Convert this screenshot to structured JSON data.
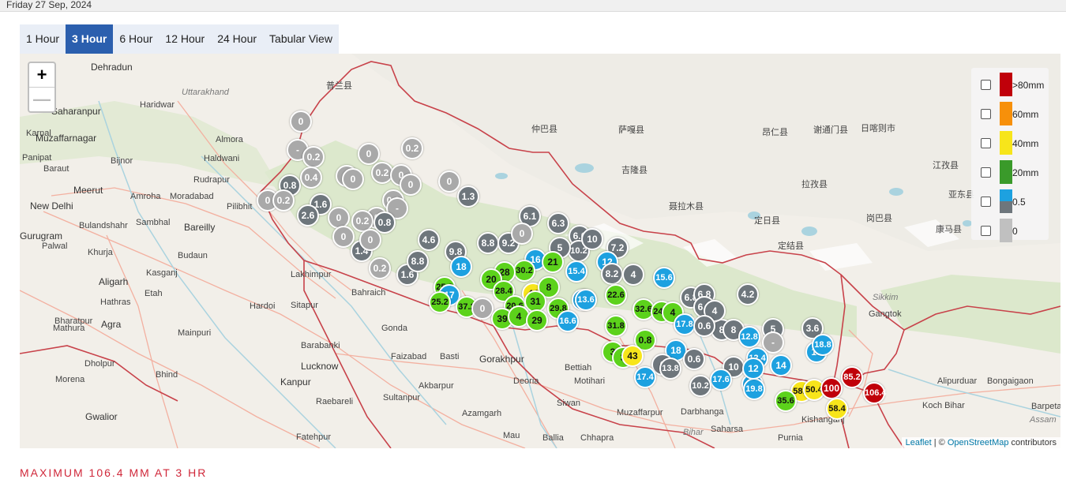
{
  "date": "Friday 27 Sep, 2024",
  "tabs": [
    {
      "label": "1 Hour",
      "active": false
    },
    {
      "label": "3 Hour",
      "active": true
    },
    {
      "label": "6 Hour",
      "active": false
    },
    {
      "label": "12 Hour",
      "active": false
    },
    {
      "label": "24 Hour",
      "active": false
    },
    {
      "label": "Tabular View",
      "active": false
    }
  ],
  "zoom": {
    "in": "+",
    "out": "—"
  },
  "legend": [
    {
      "label": ">80mm",
      "color": "#c0000a"
    },
    {
      "label": "60mm",
      "color": "#f7900a"
    },
    {
      "label": "40mm",
      "color": "#f7e51b"
    },
    {
      "label": "20mm",
      "color": "#3a9a2a"
    },
    {
      "label": "0.5",
      "color_top": "#1da1e0",
      "color_bottom": "#6e767c"
    },
    {
      "label": "0",
      "color": "#c0c0c0"
    }
  ],
  "places": [
    {
      "name": "Dehradun",
      "big": true
    },
    {
      "name": "Uttarakhand",
      "region": true
    },
    {
      "name": "Haridwar"
    },
    {
      "name": "Saharanpur",
      "big": true
    },
    {
      "name": "Karnal"
    },
    {
      "name": "Muzaffarnagar",
      "big": true
    },
    {
      "name": "Almora"
    },
    {
      "name": "Haldwani"
    },
    {
      "name": "Panipat"
    },
    {
      "name": "Baraut"
    },
    {
      "name": "Bijnor"
    },
    {
      "name": "Rudrapur"
    },
    {
      "name": "Meerut",
      "big": true
    },
    {
      "name": "Amroha"
    },
    {
      "name": "Moradabad"
    },
    {
      "name": "Pilibhit"
    },
    {
      "name": "New Delhi",
      "big": true
    },
    {
      "name": "Gurugram",
      "big": true
    },
    {
      "name": "Bulandshahr"
    },
    {
      "name": "Sambhal"
    },
    {
      "name": "Bareilly",
      "big": true
    },
    {
      "name": "Palwal"
    },
    {
      "name": "Khurja"
    },
    {
      "name": "Budaun"
    },
    {
      "name": "Lakhimpur"
    },
    {
      "name": "Aligarh",
      "big": true
    },
    {
      "name": "Kasganj"
    },
    {
      "name": "Hathras"
    },
    {
      "name": "Etah"
    },
    {
      "name": "Bahraich"
    },
    {
      "name": "Mathura"
    },
    {
      "name": "Hardoi"
    },
    {
      "name": "Sitapur"
    },
    {
      "name": "Bharatpur"
    },
    {
      "name": "Agra",
      "big": true
    },
    {
      "name": "Gonda"
    },
    {
      "name": "Mainpuri"
    },
    {
      "name": "Barabanki"
    },
    {
      "name": "Faizabad"
    },
    {
      "name": "Basti"
    },
    {
      "name": "Gorakhpur",
      "big": true
    },
    {
      "name": "Dholpur"
    },
    {
      "name": "Lucknow",
      "big": true
    },
    {
      "name": "Bettiah"
    },
    {
      "name": "Motihari"
    },
    {
      "name": "Morena"
    },
    {
      "name": "Bhind"
    },
    {
      "name": "Kanpur",
      "big": true
    },
    {
      "name": "Akbarpur"
    },
    {
      "name": "Deoria"
    },
    {
      "name": "Raebareli"
    },
    {
      "name": "Sultanpur"
    },
    {
      "name": "Siwan"
    },
    {
      "name": "Muzaffarpur"
    },
    {
      "name": "Darbhanga"
    },
    {
      "name": "Saharsa"
    },
    {
      "name": "Purnia"
    },
    {
      "name": "Gwalior",
      "big": true
    },
    {
      "name": "Azamgarh"
    },
    {
      "name": "Mau"
    },
    {
      "name": "Ballia"
    },
    {
      "name": "Chhapra"
    },
    {
      "name": "Fatehpur"
    },
    {
      "name": "Bihar",
      "region": true
    },
    {
      "name": "Kishanganj"
    },
    {
      "name": "Gangtok"
    },
    {
      "name": "Sikkim",
      "region": true
    },
    {
      "name": "Alipurduar"
    },
    {
      "name": "Bongaigaon"
    },
    {
      "name": "Koch Bihar"
    },
    {
      "name": "Barpeta"
    },
    {
      "name": "Assam",
      "region": true
    },
    {
      "name": "仲巴县"
    },
    {
      "name": "萨嘎县"
    },
    {
      "name": "吉隆县"
    },
    {
      "name": "聂拉木县"
    },
    {
      "name": "昂仁县"
    },
    {
      "name": "谢通门县"
    },
    {
      "name": "日喀则市"
    },
    {
      "name": "拉孜县"
    },
    {
      "name": "定日县"
    },
    {
      "name": "岗巴县"
    },
    {
      "name": "康马县"
    },
    {
      "name": "定结县"
    },
    {
      "name": "江孜县"
    },
    {
      "name": "亚东县"
    },
    {
      "name": "普兰县"
    }
  ],
  "markers": [
    {
      "v": "0",
      "c": "lgrey"
    },
    {
      "v": "-",
      "c": "lgrey"
    },
    {
      "v": "0.2",
      "c": "lgrey"
    },
    {
      "v": "0",
      "c": "lgrey"
    },
    {
      "v": "0.2",
      "c": "lgrey"
    },
    {
      "v": "0",
      "c": "lgrey"
    },
    {
      "v": "0.4",
      "c": "lgrey"
    },
    {
      "v": "0",
      "c": "lgrey"
    },
    {
      "v": "0.2",
      "c": "lgrey"
    },
    {
      "v": "0",
      "c": "lgrey"
    },
    {
      "v": "0",
      "c": "lgrey"
    },
    {
      "v": "0",
      "c": "lgrey"
    },
    {
      "v": "0.8",
      "c": "grey"
    },
    {
      "v": "0",
      "c": "lgrey"
    },
    {
      "v": "0.2",
      "c": "lgrey"
    },
    {
      "v": "1.6",
      "c": "grey"
    },
    {
      "v": "0.2",
      "c": "lgrey"
    },
    {
      "v": "0",
      "c": "lgrey"
    },
    {
      "v": "1.3",
      "c": "grey"
    },
    {
      "v": "2.6",
      "c": "grey"
    },
    {
      "v": "0",
      "c": "lgrey"
    },
    {
      "v": "0.2",
      "c": "lgrey"
    },
    {
      "v": "-",
      "c": "lgrey"
    },
    {
      "v": "0.8",
      "c": "grey"
    },
    {
      "v": "0",
      "c": "lgrey"
    },
    {
      "v": "1.4",
      "c": "grey"
    },
    {
      "v": "0",
      "c": "lgrey"
    },
    {
      "v": "0.2",
      "c": "lgrey"
    },
    {
      "v": "1.6",
      "c": "grey"
    },
    {
      "v": "4.6",
      "c": "grey"
    },
    {
      "v": "8.8",
      "c": "grey"
    },
    {
      "v": "9.8",
      "c": "grey"
    },
    {
      "v": "8.8",
      "c": "grey"
    },
    {
      "v": "9.2",
      "c": "grey"
    },
    {
      "v": "6.1",
      "c": "grey"
    },
    {
      "v": "0",
      "c": "lgrey"
    },
    {
      "v": "6.3",
      "c": "grey"
    },
    {
      "v": "6.6",
      "c": "grey"
    },
    {
      "v": "10.2",
      "c": "grey"
    },
    {
      "v": "7.2",
      "c": "grey"
    },
    {
      "v": "5",
      "c": "grey"
    },
    {
      "v": "10",
      "c": "grey"
    },
    {
      "v": "18",
      "c": "blue"
    },
    {
      "v": "16",
      "c": "blue"
    },
    {
      "v": "21",
      "c": "green"
    },
    {
      "v": "15.4",
      "c": "blue"
    },
    {
      "v": "12",
      "c": "blue"
    },
    {
      "v": "8.2",
      "c": "grey"
    },
    {
      "v": "4",
      "c": "grey"
    },
    {
      "v": "15.6",
      "c": "blue"
    },
    {
      "v": "6.8",
      "c": "grey"
    },
    {
      "v": "4.2",
      "c": "grey"
    },
    {
      "v": "13.6",
      "c": "blue"
    },
    {
      "v": "8",
      "c": "grey"
    },
    {
      "v": "30.2",
      "c": "green"
    },
    {
      "v": "28",
      "c": "green"
    },
    {
      "v": "25.8",
      "c": "green"
    },
    {
      "v": "20",
      "c": "green"
    },
    {
      "v": "17",
      "c": "blue"
    },
    {
      "v": "28.4",
      "c": "green"
    },
    {
      "v": "44",
      "c": "yellow"
    },
    {
      "v": "8",
      "c": "green"
    },
    {
      "v": "22.6",
      "c": "green"
    },
    {
      "v": "13.6",
      "c": "blue"
    },
    {
      "v": "6.8",
      "c": "grey"
    },
    {
      "v": "25.2",
      "c": "green"
    },
    {
      "v": "37.2",
      "c": "green"
    },
    {
      "v": "0",
      "c": "lgrey"
    },
    {
      "v": "20.6",
      "c": "green"
    },
    {
      "v": "31",
      "c": "green"
    },
    {
      "v": "29.8",
      "c": "green"
    },
    {
      "v": "32.6",
      "c": "green"
    },
    {
      "v": "24.4",
      "c": "green"
    },
    {
      "v": "4",
      "c": "green"
    },
    {
      "v": "6.8",
      "c": "grey"
    },
    {
      "v": "4",
      "c": "grey"
    },
    {
      "v": "39",
      "c": "green"
    },
    {
      "v": "4",
      "c": "green"
    },
    {
      "v": "29",
      "c": "green"
    },
    {
      "v": "16.6",
      "c": "blue"
    },
    {
      "v": "31.8",
      "c": "green"
    },
    {
      "v": "17.8",
      "c": "blue"
    },
    {
      "v": "0.6",
      "c": "grey"
    },
    {
      "v": "8",
      "c": "grey"
    },
    {
      "v": "12.8",
      "c": "blue"
    },
    {
      "v": "5",
      "c": "grey"
    },
    {
      "v": "3.6",
      "c": "grey"
    },
    {
      "v": "-",
      "c": "lgrey"
    },
    {
      "v": "0.8",
      "c": "green"
    },
    {
      "v": "18",
      "c": "blue"
    },
    {
      "v": "0.6",
      "c": "grey"
    },
    {
      "v": "10",
      "c": "grey"
    },
    {
      "v": "12.4",
      "c": "blue"
    },
    {
      "v": "13",
      "c": "blue"
    },
    {
      "v": "18.8",
      "c": "blue"
    },
    {
      "v": "3",
      "c": "green"
    },
    {
      "v": "3",
      "c": "green"
    },
    {
      "v": "43",
      "c": "yellow"
    },
    {
      "v": "6",
      "c": "grey"
    },
    {
      "v": "13.8",
      "c": "grey"
    },
    {
      "v": "17.4",
      "c": "blue"
    },
    {
      "v": "17.6",
      "c": "blue"
    },
    {
      "v": "10.2",
      "c": "grey"
    },
    {
      "v": "18",
      "c": "blue"
    },
    {
      "v": "19.8",
      "c": "blue"
    },
    {
      "v": "12",
      "c": "blue"
    },
    {
      "v": "14",
      "c": "blue"
    },
    {
      "v": "58.4",
      "c": "yellow"
    },
    {
      "v": "50.4",
      "c": "yellow"
    },
    {
      "v": "100",
      "c": "red"
    },
    {
      "v": "85.2",
      "c": "red"
    },
    {
      "v": "106.4",
      "c": "red"
    },
    {
      "v": "58.4",
      "c": "yellow"
    },
    {
      "v": "35.6",
      "c": "green"
    }
  ],
  "attribution": {
    "leaflet": "Leaflet",
    "sep": " | © ",
    "osm": "OpenStreetMap",
    "rest": " contributors"
  },
  "max_text": "MAXIMUM 106.4 MM AT 3 HR"
}
